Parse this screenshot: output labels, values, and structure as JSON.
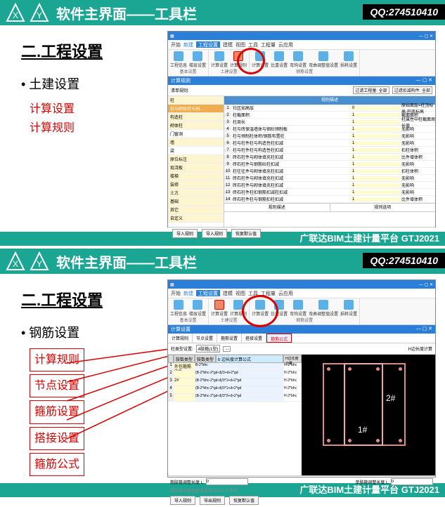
{
  "common": {
    "headerTitle": "软件主界面——工具栏",
    "qq": "QQ:274510410",
    "footer": "广联达BIM土建计量平台 GTJ2021",
    "section": "二.工程设置"
  },
  "slide1": {
    "bullet": "• 土建设置",
    "subs": [
      "计算设置",
      "计算规则"
    ],
    "winTitle": "广联达BIM土建计量平台 GTJ2021",
    "menus": [
      "开始",
      "新建",
      "工程设置",
      "建模",
      "视图",
      "工具",
      "工程量",
      "云应用"
    ],
    "ribbonItems": [
      "工程信息",
      "楼层设置",
      "计算设置",
      "计算规则",
      "土建设置",
      "计算设置",
      "比重设置",
      "弯钩设置",
      "弯曲调整值设置",
      "损耗设置",
      "钢筋设置"
    ],
    "ribbonGroups": [
      "基本设置",
      "土建设置",
      "钢筋设置"
    ],
    "subbar": "计算规则",
    "filterL": "清单规则:",
    "filterLv": "过滤工程量: 全部",
    "filterR": "过滤扣减构件: 全部",
    "treeItems": [
      "柱",
      "柱与砌体柱与预...",
      "构造柱",
      "砌体柱",
      "门窗洞",
      "墙",
      "梁",
      "原位标注",
      "现浇板",
      "楼梯",
      "装修",
      "土方",
      "基础",
      "其它",
      "自定义"
    ],
    "gridHdr": "规则描述",
    "cols": [
      "社区如高层",
      "柱截面积",
      "柱周长",
      "柱与砖保温墙体与钢砼预制板",
      "柱与预制柱体积/钢筋布置柱",
      "柱与柱件柱与构造性柱扣减",
      "柱与柱件柱与构造性柱扣减",
      "砖石柱件与砌体填充柱扣减",
      "砖石柱件与钢筋砼柱扣减",
      "柱往往件与砌体填充柱扣减",
      "砖石柱件与砌体填充柱扣减",
      "砖石柱件与砌体填充柱扣减",
      "砖石柱件柱扣钢筋扣减柱扣减",
      "砖石柱件柱与钢筋扣柱扣减"
    ],
    "valCol": [
      "原始面层=柱顶标高-柱底标高",
      "截面面积",
      "柱属性中柱截面周长值",
      "无影响",
      "无影响",
      "无影响",
      "扣柱体积",
      "比件增体积",
      "无影响",
      "扣柱体积",
      "无影响",
      "无影响",
      "无影响",
      "比件增体积",
      "比件选件体积"
    ],
    "btmL": "规则描述",
    "btmR": "规则选项",
    "btns": [
      "导入规则",
      "导入规则",
      "恢复默认值"
    ]
  },
  "slide2": {
    "bullet": "• 钢筋设置",
    "subs": [
      "计算规则",
      "节点设置",
      "箍筋设置",
      "搭接设置",
      "箍筋公式"
    ],
    "subbar": "计算设置",
    "ddLabel": "柱类型设置:",
    "ddVal": "4肢箍(1型)",
    "moreBtn": "...",
    "tabs": [
      "计算规则",
      "节点设置",
      "箍筋设置",
      "搭接设置",
      "箍筋公式"
    ],
    "tblHdr": [
      "肢数类型",
      "肢数类型",
      "b 边长度计算公式",
      "H边长度计算"
    ],
    "rows": [
      {
        "n": "1",
        "a": "外包箍筋(1#)",
        "b": "B-2*bhc",
        "c": "H-2*bhc"
      },
      {
        "n": "2",
        "a": "",
        "b": "(B-2*bhc-2*gd-d)/3+d+2*gd",
        "c": "H-2*bhc"
      },
      {
        "n": "3",
        "a": "2#",
        "b": "(B-2*bhc-2*gd-d)/3*1+d+2*gd",
        "c": "H-2*bhc"
      },
      {
        "n": "4",
        "a": "",
        "b": "(B-2*bhc-2*gd-d)/3*1+d+2*gd",
        "c": "H-2*bhc"
      },
      {
        "n": "5",
        "a": "",
        "b": "(B-2*bhc-2*gd-d)/3*2+d+2*gd",
        "c": "H-2*bhc"
      }
    ],
    "hoops": [
      "2#",
      "1#"
    ],
    "fld1": "筋肢箍调整长度 L:",
    "fld1v": "0",
    "fld2": "单肢箍调整长度 L:",
    "fld2v": "0",
    "note": "提示当前框选区提取显示中此件等号。",
    "btns": [
      "导入规则",
      "导出规则",
      "恢复默认值"
    ]
  }
}
